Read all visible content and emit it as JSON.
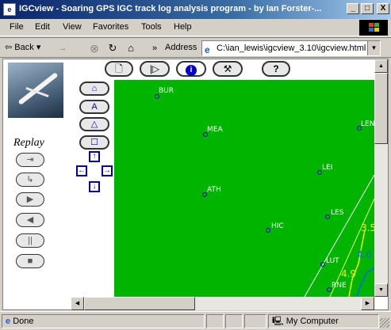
{
  "window": {
    "title": "IGCview - Soaring GPS IGC track log analysis program - by Ian Forster-...",
    "app_icon": "ie-page-icon",
    "controls": {
      "minimize": "_",
      "maximize": "□",
      "close": "X"
    }
  },
  "menu": [
    "File",
    "Edit",
    "View",
    "Favorites",
    "Tools",
    "Help"
  ],
  "toolbar": {
    "back_label": "Back",
    "forward_icon": "→",
    "stop_icon": "⊗",
    "refresh_icon": "↻",
    "home_icon": "⌂",
    "more_icon": "»",
    "address_label": "Address",
    "address_value": "C:\\ian_lewis\\igcview_3.10\\igcview.html",
    "dropdown_icon": "▼"
  },
  "applet": {
    "top_buttons": [
      "🗋",
      "|▷",
      "i",
      "⚒",
      "?"
    ],
    "replay_label": "Replay",
    "replay_buttons": [
      "⇥",
      "↳",
      "▶",
      "◀",
      "||",
      "■"
    ],
    "tool_buttons": [
      "⌂",
      "A",
      "△",
      "☐"
    ],
    "pan_arrows": {
      "up": "↑",
      "left": "←",
      "right": "→",
      "down": "↓"
    },
    "map": {
      "background_color": "#00b400",
      "waypoints": [
        {
          "label": "BUR"
        },
        {
          "label": "MEA"
        },
        {
          "label": "LEN"
        },
        {
          "label": "LEI"
        },
        {
          "label": "ATH"
        },
        {
          "label": "LES"
        },
        {
          "label": "HIC"
        },
        {
          "label": "LUT"
        },
        {
          "label": "RNE"
        }
      ],
      "track_labels": [
        "3.5",
        "4.0",
        "4.9"
      ]
    }
  },
  "status": {
    "page_state": "Done",
    "zone": "My Computer"
  }
}
